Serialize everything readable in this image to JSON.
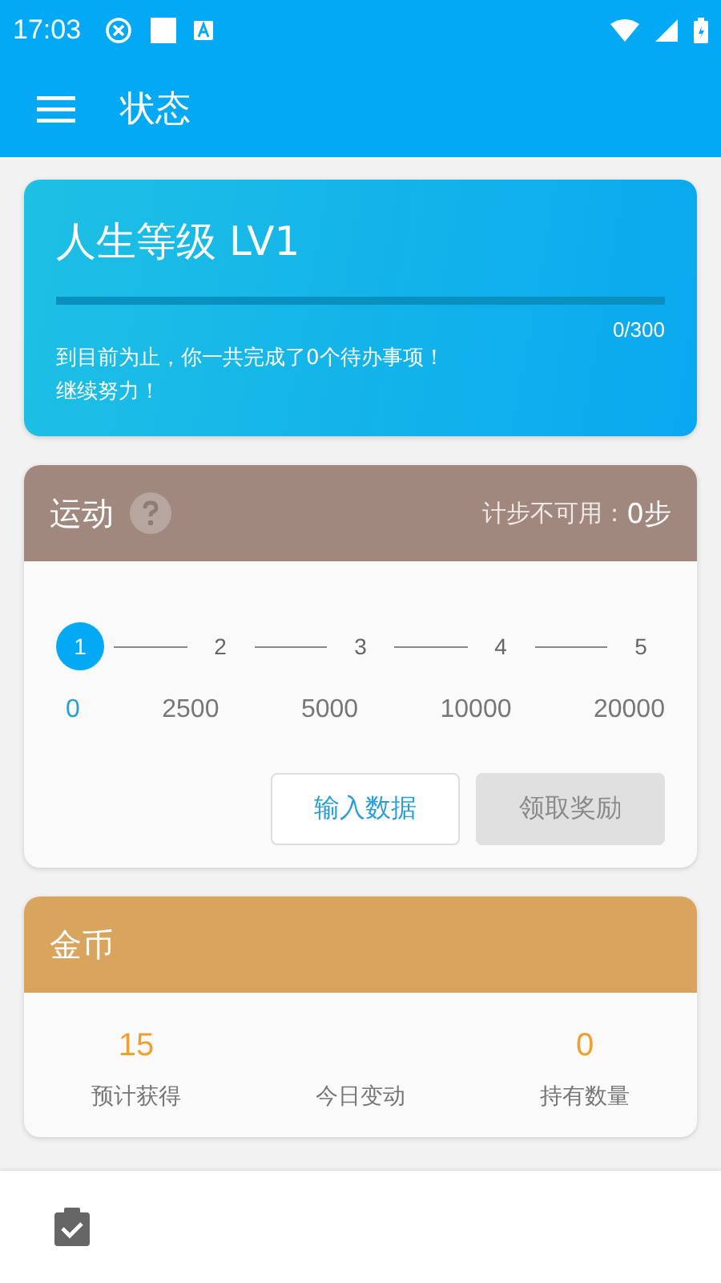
{
  "status_bar": {
    "time": "17:03"
  },
  "app_bar": {
    "title": "状态"
  },
  "level_card": {
    "title": "人生等级 LV1",
    "level": 0,
    "reading": "0/300",
    "message": [
      "到目前为止，你一共完成了0个待办事项！",
      "继续努力！"
    ]
  },
  "exercise_card": {
    "title": "运动",
    "status_label": "计步不可用：",
    "status_value": "0步",
    "steps": [
      {
        "number": "1",
        "threshold": "0",
        "selected": true
      },
      {
        "number": "2",
        "threshold": "2500",
        "selected": false
      },
      {
        "number": "3",
        "threshold": "5000",
        "selected": false
      },
      {
        "number": "4",
        "threshold": "10000",
        "selected": false
      },
      {
        "number": "5",
        "threshold": "20000",
        "selected": false
      }
    ],
    "buttons": [
      {
        "label": "输入数据",
        "disabled": false
      },
      {
        "label": "领取奖励",
        "disabled": true
      }
    ]
  },
  "coin_card": {
    "title": "金币",
    "stats": [
      {
        "value": "15",
        "label": "预计获得"
      },
      {
        "label": "今日变动"
      },
      {
        "value": "0",
        "label": "持有数量"
      }
    ]
  },
  "bottom_nav": {
    "items": [
      {
        "kind": "tasks",
        "selected": true
      }
    ]
  }
}
